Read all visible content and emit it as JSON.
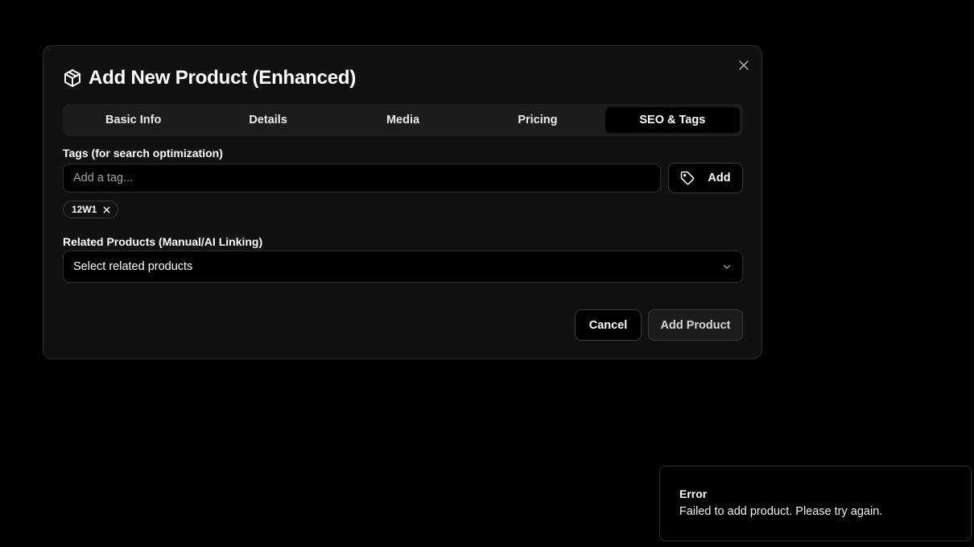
{
  "modal": {
    "title": "Add New Product (Enhanced)",
    "title_icon": "package-icon",
    "close_icon": "close-icon",
    "tabs": [
      {
        "label": "Basic Info",
        "active": false
      },
      {
        "label": "Details",
        "active": false
      },
      {
        "label": "Media",
        "active": false
      },
      {
        "label": "Pricing",
        "active": false
      },
      {
        "label": "SEO & Tags",
        "active": true
      }
    ],
    "tags": {
      "label": "Tags (for search optimization)",
      "input_value": "",
      "placeholder": "Add a tag...",
      "add_label": "Add",
      "add_icon": "tag-icon",
      "chips": [
        {
          "label": "12W1"
        }
      ]
    },
    "related": {
      "label": "Related Products (Manual/AI Linking)",
      "select_value": "Select related products",
      "icon": "chevron-down-icon"
    },
    "actions": {
      "cancel_label": "Cancel",
      "submit_label": "Add Product"
    }
  },
  "toast": {
    "title": "Error",
    "message": "Failed to add product. Please try again."
  },
  "colors": {
    "background": "#000000",
    "modal_bg": "#111111",
    "border": "#2f2f2f",
    "text": "#ffffff",
    "muted": "#a3a3a3"
  }
}
